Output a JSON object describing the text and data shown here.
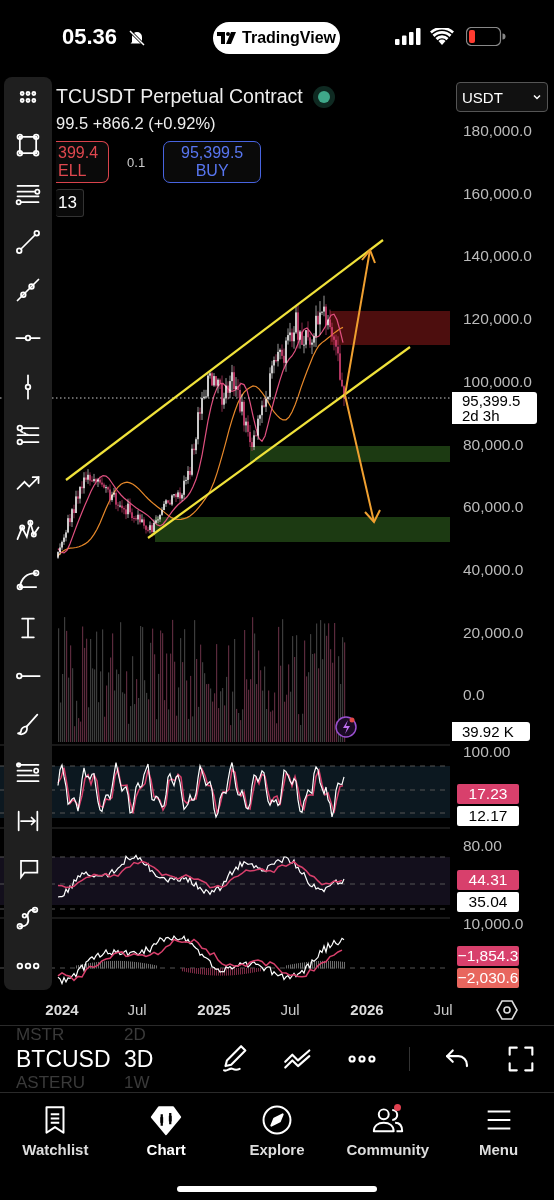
{
  "status_bar": {
    "time": "05.36",
    "app_pill": "TradingView"
  },
  "chart": {
    "title": "TCUSDT Perpetual Contract",
    "quote": "99.5 +866.2 (+0.92%)",
    "sell": {
      "price": "399.4",
      "label": "ELL"
    },
    "spread": "0.1",
    "buy": {
      "price": "95,399.5",
      "label": "BUY"
    },
    "interval_badge": "13",
    "currency": "USDT",
    "price_axis": [
      "180,000.0",
      "160,000.0",
      "140,000.0",
      "120,000.0",
      "100,000.0",
      "80,000.0",
      "60,000.0",
      "40,000.0",
      "20,000.0",
      "0.0"
    ],
    "last_price": {
      "price": "95,399.5",
      "countdown": "2d 3h"
    },
    "volume_label": "39.92 K"
  },
  "panes": [
    {
      "scale_label": "100.00",
      "values": [
        {
          "text": "17.23",
          "color": "#d8406c"
        },
        {
          "text": "12.17",
          "color": "#ffffff"
        }
      ]
    },
    {
      "scale_label": "80.00",
      "values": [
        {
          "text": "44.31",
          "color": "#d8406c"
        },
        {
          "text": "35.04",
          "color": "#ffffff"
        }
      ]
    },
    {
      "scale_label": "10,000.0",
      "values": [
        {
          "text": "−1,854.3",
          "color": "#d8406c"
        },
        {
          "text": "−2,030.6",
          "color": "#e8665e"
        }
      ]
    }
  ],
  "time_axis": [
    {
      "label": "2024",
      "kind": "year"
    },
    {
      "label": "Jul",
      "kind": "month"
    },
    {
      "label": "2025",
      "kind": "year"
    },
    {
      "label": "Jul",
      "kind": "month"
    },
    {
      "label": "2026",
      "kind": "year"
    },
    {
      "label": "Jul",
      "kind": "month"
    }
  ],
  "symbol_picker": {
    "previous": {
      "symbol": "MSTR",
      "interval": "2D"
    },
    "current": {
      "symbol": "BTCUSD",
      "interval": "3D"
    },
    "next": {
      "symbol": "ASTERU",
      "interval": "1W"
    }
  },
  "tab_bar": [
    {
      "label": "Watchlist",
      "selected": false,
      "notification": false
    },
    {
      "label": "Chart",
      "selected": true,
      "notification": false
    },
    {
      "label": "Explore",
      "selected": false,
      "notification": false
    },
    {
      "label": "Community",
      "selected": false,
      "notification": true
    },
    {
      "label": "Menu",
      "selected": false,
      "notification": false
    }
  ]
}
